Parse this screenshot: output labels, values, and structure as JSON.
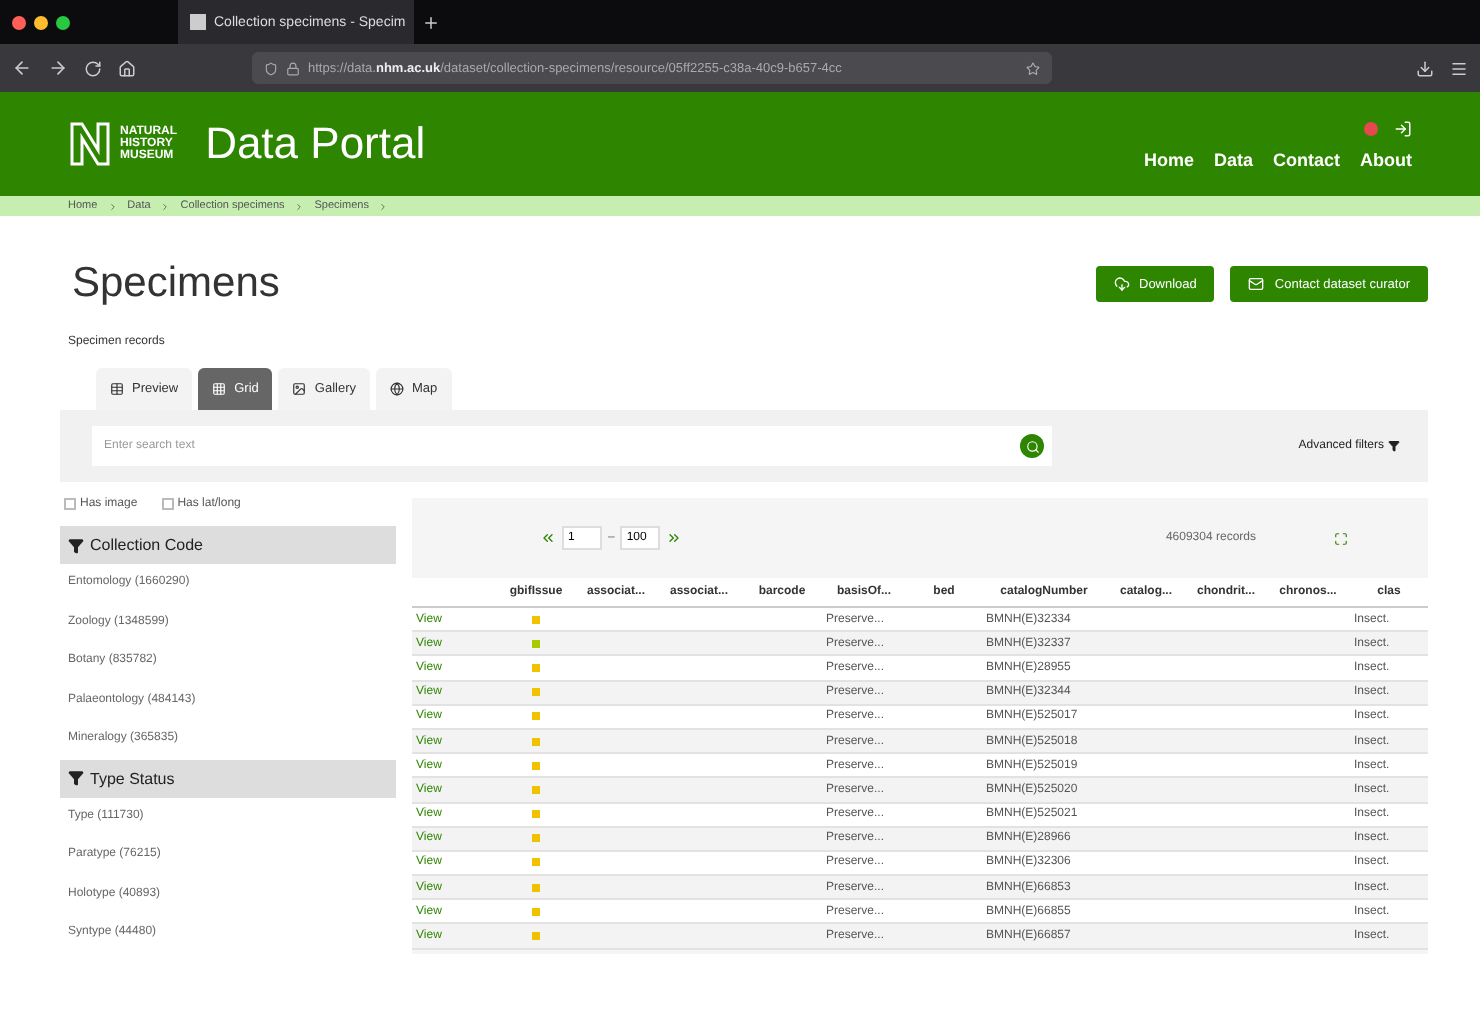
{
  "browser": {
    "tab_title": "Collection specimens - Specim",
    "url_prefix": "https://data.",
    "url_domain": "nhm.ac.uk",
    "url_rest": "/dataset/collection-specimens/resource/05ff2255-c38a-40c9-b657-4cc"
  },
  "header": {
    "logo_lines": [
      "NATURAL",
      "HISTORY",
      "MUSEUM"
    ],
    "title": "Data Portal",
    "nav": [
      "Home",
      "Data",
      "Contact",
      "About"
    ]
  },
  "breadcrumb": [
    "Home",
    "Data",
    "Collection specimens",
    "Specimens"
  ],
  "page": {
    "title": "Specimens",
    "subtitle": "Specimen records",
    "buttons": [
      {
        "kind": "download",
        "label": "Download"
      },
      {
        "kind": "contact",
        "label": "Contact dataset curator"
      }
    ]
  },
  "tabs": [
    {
      "kind": "table",
      "label": "Preview",
      "selected": false
    },
    {
      "kind": "grid",
      "label": "Grid",
      "selected": true
    },
    {
      "kind": "image",
      "label": "Gallery",
      "selected": false
    },
    {
      "kind": "globe",
      "label": "Map",
      "selected": false
    }
  ],
  "search": {
    "placeholder": "Enter search text",
    "advanced": "Advanced filters"
  },
  "checkboxes": [
    {
      "label": "Has image",
      "checked": false
    },
    {
      "label": "Has lat/long",
      "checked": false
    }
  ],
  "facets": [
    {
      "title": "Collection Code",
      "items": [
        "Entomology (1660290)",
        "Zoology (1348599)",
        "Botany (835782)",
        "Palaeontology (484143)",
        "Mineralogy (365835)"
      ]
    },
    {
      "title": "Type Status",
      "items": [
        "Type (111730)",
        "Paratype (76215)",
        "Holotype (40893)",
        "Syntype (44480)"
      ]
    }
  ],
  "pager": {
    "from": "1",
    "dash": "–",
    "to": "100",
    "records": "4609304 records"
  },
  "table": {
    "columns": [
      "",
      "gbifIssue",
      "associat...",
      "associat...",
      "barcode",
      "basisOf...",
      "bed",
      "catalogNumber",
      "catalog...",
      "chondrit...",
      "chronos...",
      "clas"
    ],
    "rows": [
      {
        "view": "View",
        "color": "#f2c200",
        "basis": "Preserve...",
        "catalog": "BMNH(E)32334",
        "class": "Insect."
      },
      {
        "view": "View",
        "color": "#a8c800",
        "basis": "Preserve...",
        "catalog": "BMNH(E)32337",
        "class": "Insect."
      },
      {
        "view": "View",
        "color": "#f2c200",
        "basis": "Preserve...",
        "catalog": "BMNH(E)28955",
        "class": "Insect."
      },
      {
        "view": "View",
        "color": "#f2c200",
        "basis": "Preserve...",
        "catalog": "BMNH(E)32344",
        "class": "Insect."
      },
      {
        "view": "View",
        "color": "#f2c200",
        "basis": "Preserve...",
        "catalog": "BMNH(E)525017",
        "class": "Insect."
      },
      {
        "view": "View",
        "color": "#f2c200",
        "basis": "Preserve...",
        "catalog": "BMNH(E)525018",
        "class": "Insect."
      },
      {
        "view": "View",
        "color": "#f2c200",
        "basis": "Preserve...",
        "catalog": "BMNH(E)525019",
        "class": "Insect."
      },
      {
        "view": "View",
        "color": "#f2c200",
        "basis": "Preserve...",
        "catalog": "BMNH(E)525020",
        "class": "Insect."
      },
      {
        "view": "View",
        "color": "#f2c200",
        "basis": "Preserve...",
        "catalog": "BMNH(E)525021",
        "class": "Insect."
      },
      {
        "view": "View",
        "color": "#f2c200",
        "basis": "Preserve...",
        "catalog": "BMNH(E)28966",
        "class": "Insect."
      },
      {
        "view": "View",
        "color": "#f2c200",
        "basis": "Preserve...",
        "catalog": "BMNH(E)32306",
        "class": "Insect."
      },
      {
        "view": "View",
        "color": "#f2c200",
        "basis": "Preserve...",
        "catalog": "BMNH(E)66853",
        "class": "Insect."
      },
      {
        "view": "View",
        "color": "#f2c200",
        "basis": "Preserve...",
        "catalog": "BMNH(E)66855",
        "class": "Insect."
      },
      {
        "view": "View",
        "color": "#f2c200",
        "basis": "Preserve...",
        "catalog": "BMNH(E)66857",
        "class": "Insect."
      }
    ]
  }
}
